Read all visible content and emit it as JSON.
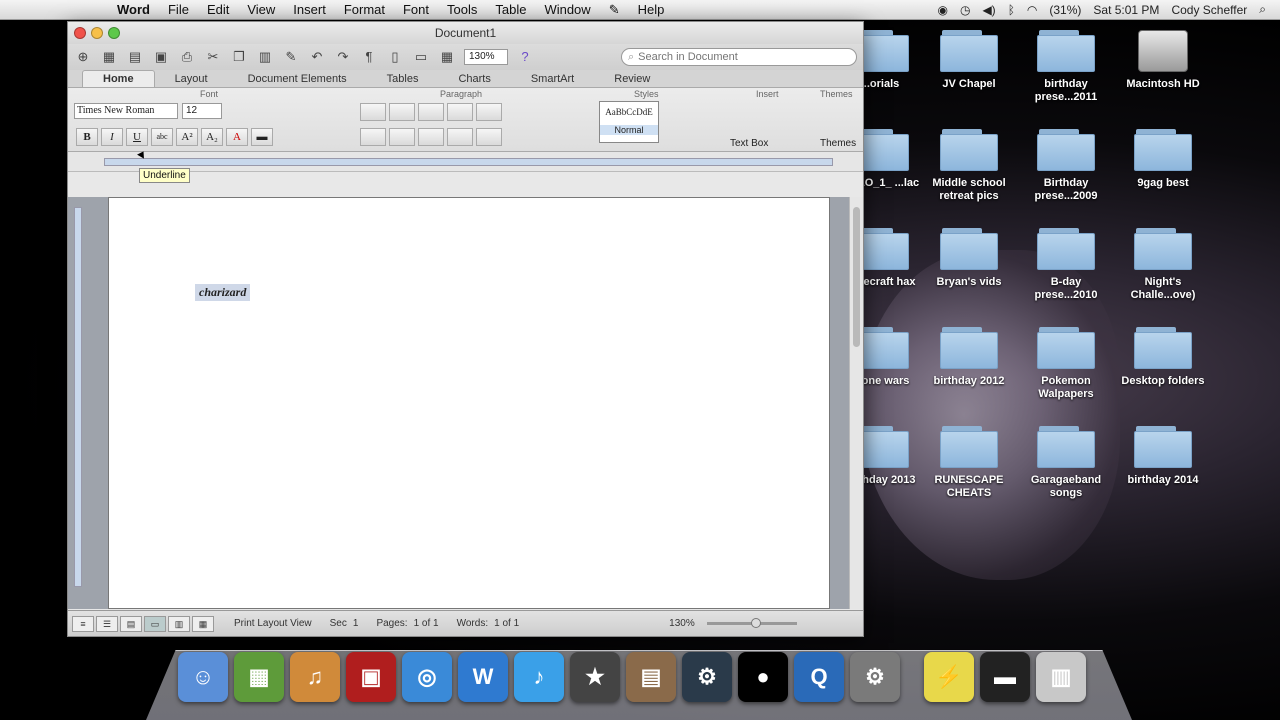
{
  "menubar": {
    "items": [
      "Word",
      "File",
      "Edit",
      "View",
      "Insert",
      "Format",
      "Font",
      "Tools",
      "Table",
      "Window",
      "Help"
    ],
    "battery": "(31%)",
    "clock": "Sat 5:01 PM",
    "user": "Cody Scheffer"
  },
  "desktop": {
    "icons": [
      {
        "label": "...orials",
        "type": "folder"
      },
      {
        "label": "JV Chapel",
        "type": "folder"
      },
      {
        "label": "birthday prese...2011",
        "type": "folder"
      },
      {
        "label": "Macintosh HD",
        "type": "drive"
      },
      {
        "label": "...ALO_1_ ...lac",
        "type": "folder"
      },
      {
        "label": "Middle school retreat pics",
        "type": "folder"
      },
      {
        "label": "Birthday prese...2009",
        "type": "folder"
      },
      {
        "label": "9gag best",
        "type": "folder"
      },
      {
        "label": "Minecraft hax",
        "type": "folder"
      },
      {
        "label": "Bryan's vids",
        "type": "folder"
      },
      {
        "label": "B-day prese...2010",
        "type": "folder"
      },
      {
        "label": "Night's Challe...ove)",
        "type": "folder"
      },
      {
        "label": "Clone wars",
        "type": "folder"
      },
      {
        "label": "birthday 2012",
        "type": "folder"
      },
      {
        "label": "Pokemon Walpapers",
        "type": "folder"
      },
      {
        "label": "Desktop folders",
        "type": "folder"
      },
      {
        "label": "birthday 2013",
        "type": "folder"
      },
      {
        "label": "RUNESCAPE CHEATS",
        "type": "folder"
      },
      {
        "label": "Garagaeband songs",
        "type": "folder"
      },
      {
        "label": "birthday 2014",
        "type": "folder"
      }
    ]
  },
  "word": {
    "window_title": "Document1",
    "zoom": "130%",
    "search_placeholder": "Search in Document",
    "tabs": [
      "Home",
      "Layout",
      "Document Elements",
      "Tables",
      "Charts",
      "SmartArt",
      "Review"
    ],
    "active_tab": "Home",
    "ribbon": {
      "font_group": "Font",
      "paragraph_group": "Paragraph",
      "styles_group": "Styles",
      "insert_group": "Insert",
      "themes_group": "Themes",
      "font_name": "Times New Roman",
      "font_size": "12",
      "style_sample": "AaBbCcDdE",
      "style_name": "Normal",
      "text_box": "Text Box",
      "themes": "Themes"
    },
    "tooltip": "Underline",
    "document_text": "charizard",
    "status": {
      "view": "Print Layout View",
      "sec_label": "Sec",
      "sec": "1",
      "pages_label": "Pages:",
      "pages": "1 of 1",
      "words_label": "Words:",
      "words": "1 of 1",
      "zoom": "130%"
    }
  },
  "dock": {
    "apps": [
      {
        "name": "Finder",
        "color": "#5a8fd8",
        "glyph": "☺"
      },
      {
        "name": "Minecraft",
        "color": "#5e9b3a",
        "glyph": "▦"
      },
      {
        "name": "GarageBand",
        "color": "#d08a3a",
        "glyph": "♫"
      },
      {
        "name": "Photo Booth",
        "color": "#b01e1e",
        "glyph": "▣"
      },
      {
        "name": "Safari",
        "color": "#3a8ad8",
        "glyph": "◎"
      },
      {
        "name": "Word",
        "color": "#2f7ad0",
        "glyph": "W"
      },
      {
        "name": "iTunes",
        "color": "#3aa0e8",
        "glyph": "♪"
      },
      {
        "name": "iMovie",
        "color": "#444444",
        "glyph": "★"
      },
      {
        "name": "iPhoto",
        "color": "#8a6a4a",
        "glyph": "▤"
      },
      {
        "name": "Steam",
        "color": "#2a3a4a",
        "glyph": "⚙"
      },
      {
        "name": "Pong",
        "color": "#000000",
        "glyph": "●"
      },
      {
        "name": "QuickTime",
        "color": "#2a6ab8",
        "glyph": "Q"
      },
      {
        "name": "System Preferences",
        "color": "#7a7a7a",
        "glyph": "⚙"
      },
      {
        "name": "Downloads",
        "color": "#e8d84a",
        "glyph": "⚡"
      },
      {
        "name": "Documents",
        "color": "#222222",
        "glyph": "▬"
      },
      {
        "name": "Trash",
        "color": "#c8c8c8",
        "glyph": "▥"
      }
    ]
  }
}
